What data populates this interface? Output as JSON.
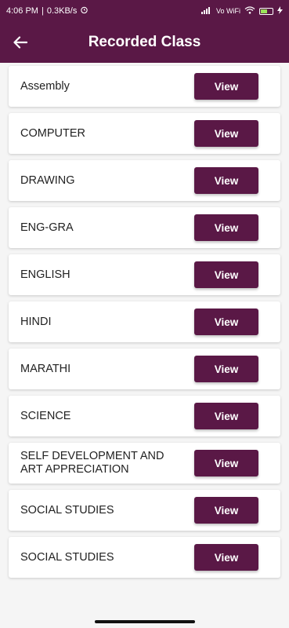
{
  "status_bar": {
    "time": "4:06 PM",
    "network_speed": "0.3KB/s",
    "alarm_icon": "alarm-icon",
    "signal_text": "Vo WiFi",
    "wifi_icon": "wifi-icon",
    "battery_icon": "battery-icon",
    "charging_icon": "charging-icon"
  },
  "app_bar": {
    "title": "Recorded Class",
    "back_icon": "back-arrow-icon"
  },
  "colors": {
    "primary": "#5a1846",
    "background": "#f5f5f5",
    "card": "#ffffff"
  },
  "classes": [
    {
      "name": "Assembly",
      "button_label": "View"
    },
    {
      "name": "COMPUTER",
      "button_label": "View"
    },
    {
      "name": "DRAWING",
      "button_label": "View"
    },
    {
      "name": "ENG-GRA",
      "button_label": "View"
    },
    {
      "name": "ENGLISH",
      "button_label": "View"
    },
    {
      "name": "HINDI",
      "button_label": "View"
    },
    {
      "name": "MARATHI",
      "button_label": "View"
    },
    {
      "name": "SCIENCE",
      "button_label": "View"
    },
    {
      "name": "SELF DEVELOPMENT AND ART APPRECIATION",
      "button_label": "View"
    },
    {
      "name": "SOCIAL STUDIES",
      "button_label": "View"
    },
    {
      "name": "SOCIAL STUDIES",
      "button_label": "View"
    }
  ]
}
